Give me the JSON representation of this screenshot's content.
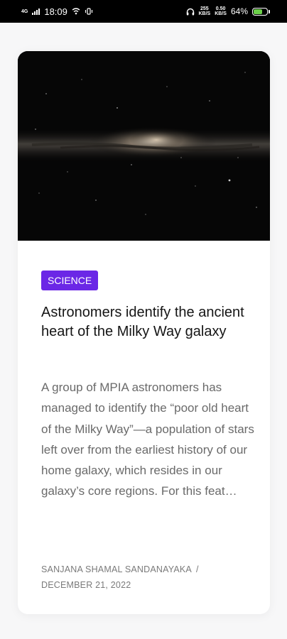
{
  "status_bar": {
    "network_type": "4G",
    "time": "18:09",
    "speed_top": "255",
    "speed_unit": "KB/S",
    "data_top": "0.50",
    "data_bottom": "KB/S",
    "battery_percent": "64%",
    "battery_level": 0.64,
    "battery_color": "#6cd04a"
  },
  "article": {
    "image_alt": "Milky Way galaxy",
    "category": "SCIENCE",
    "category_color": "#6b27e6",
    "title": "Astronomers identify the ancient heart of the Milky Way galaxy",
    "excerpt": "A group of MPIA astronomers has managed to identify the “poor old heart of the Milky Way”—a population of stars left over from the earliest history of our home galaxy, which resides in our galaxy’s core regions. For this feat…",
    "author": "SANJANA SHAMAL SANDANAYAKA",
    "separator": "/",
    "date": "DECEMBER 21, 2022"
  }
}
